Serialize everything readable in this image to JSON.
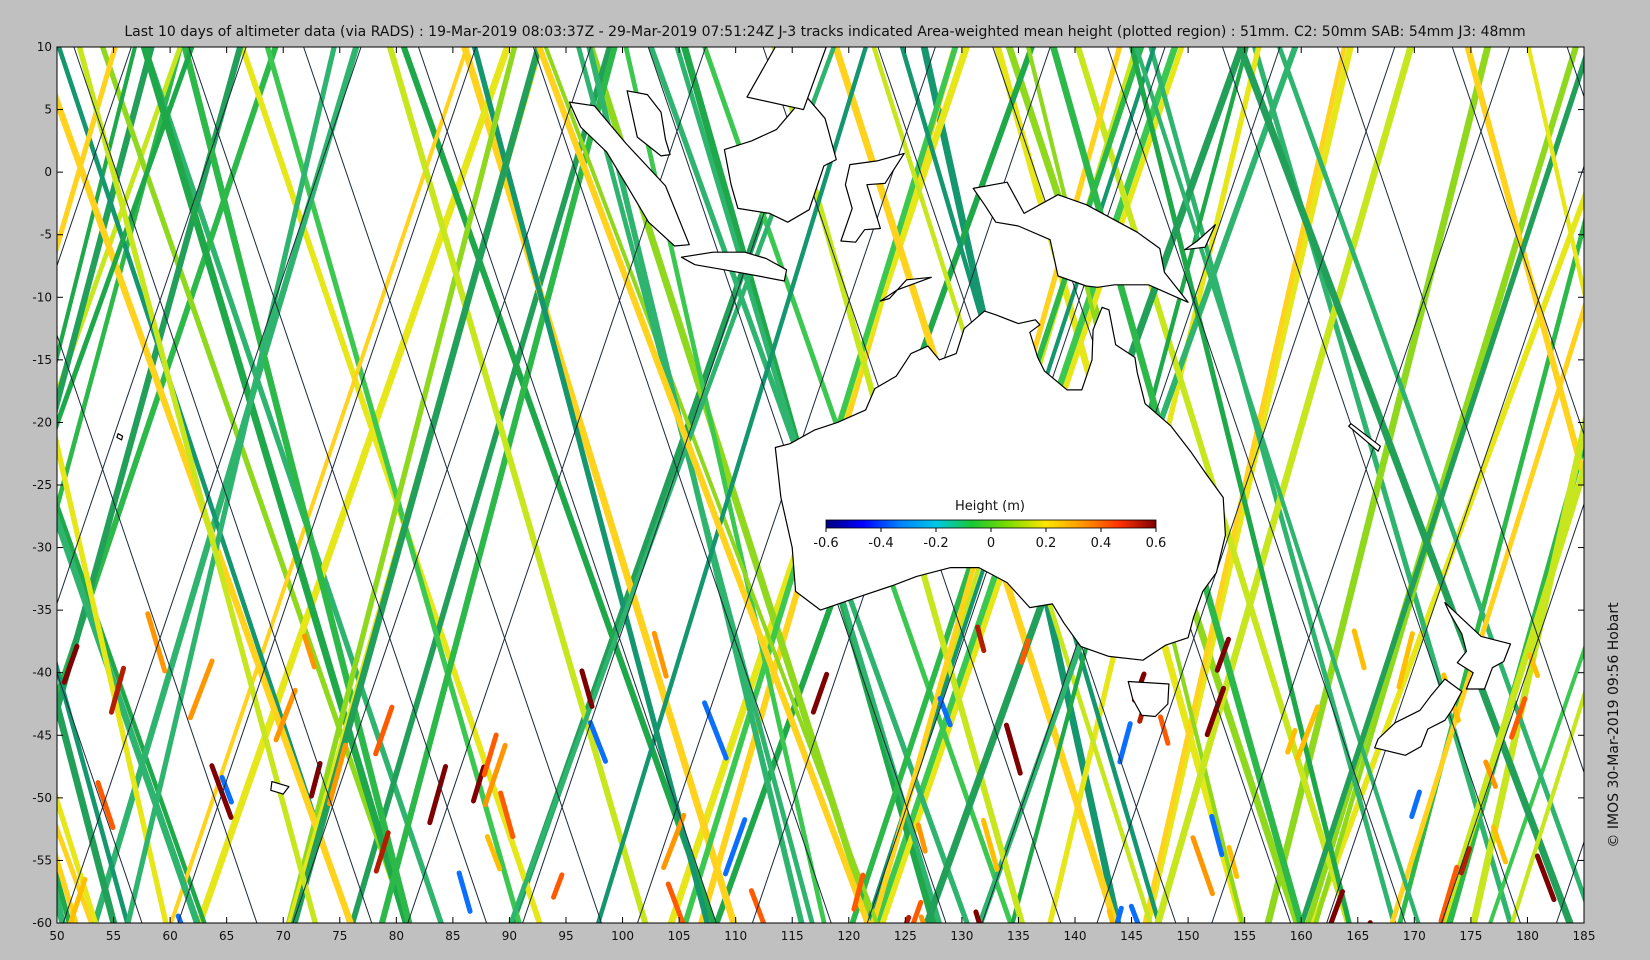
{
  "title": "Last 10 days of altimeter data (via RADS) : 19-Mar-2019 08:03:37Z - 29-Mar-2019 07:51:24Z  J-3 tracks indicated  Area-weighted mean height (plotted region) : 51mm.  C2: 50mm  SAB: 54mm  J3: 48mm",
  "credit": "© IMOS 30-Mar-2019 09:56 Hobart",
  "axes": {
    "lon_range": [
      50,
      185
    ],
    "lat_range": [
      -60,
      10
    ],
    "x_ticks": [
      "50",
      "55",
      "60",
      "65",
      "70",
      "75",
      "80",
      "85",
      "90",
      "95",
      "100",
      "105",
      "110",
      "115",
      "120",
      "125",
      "130",
      "135",
      "140",
      "145",
      "150",
      "155",
      "160",
      "165",
      "170",
      "175",
      "180",
      "185"
    ],
    "y_ticks": [
      "10",
      "5",
      "0",
      "-5",
      "-10",
      "-15",
      "-20",
      "-25",
      "-30",
      "-35",
      "-40",
      "-45",
      "-50",
      "-55",
      "-60"
    ]
  },
  "colorbar": {
    "title": "Height (m)",
    "range": [
      -0.6,
      0.6
    ],
    "ticks": [
      "-0.6",
      "-0.4",
      "-0.2",
      "0",
      "0.2",
      "0.4",
      "0.6"
    ],
    "colors": [
      "#00007f",
      "#0000ff",
      "#007fff",
      "#00c8e6",
      "#19c832",
      "#7fdc00",
      "#ffe600",
      "#ff9600",
      "#ff3200",
      "#7f0000"
    ]
  },
  "colors": {
    "background": "#c0c0c0",
    "ocean": "#ffffff",
    "land": "#ffffff",
    "coast": "#000000",
    "track_green": "#2db84a",
    "track_yellow": "#c8e61e"
  }
}
